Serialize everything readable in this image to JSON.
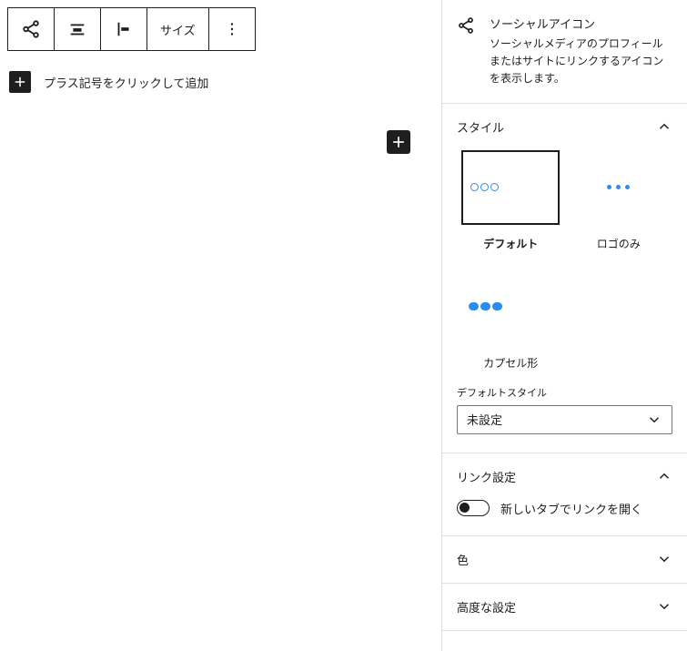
{
  "toolbar": {
    "size_label": "サイズ"
  },
  "editor": {
    "add_prompt": "プラス記号をクリックして追加"
  },
  "sidebar": {
    "block": {
      "title": "ソーシャルアイコン",
      "description": "ソーシャルメディアのプロフィールまたはサイトにリンクするアイコンを表示します。"
    },
    "panels": {
      "style": {
        "title": "スタイル",
        "options": {
          "default": "デフォルト",
          "logo_only": "ロゴのみ",
          "pill": "カプセル形"
        },
        "default_style_label": "デフォルトスタイル",
        "default_style_value": "未設定"
      },
      "link": {
        "title": "リンク設定",
        "new_tab_label": "新しいタブでリンクを開く"
      },
      "color": {
        "title": "色"
      },
      "advanced": {
        "title": "高度な設定"
      }
    }
  }
}
